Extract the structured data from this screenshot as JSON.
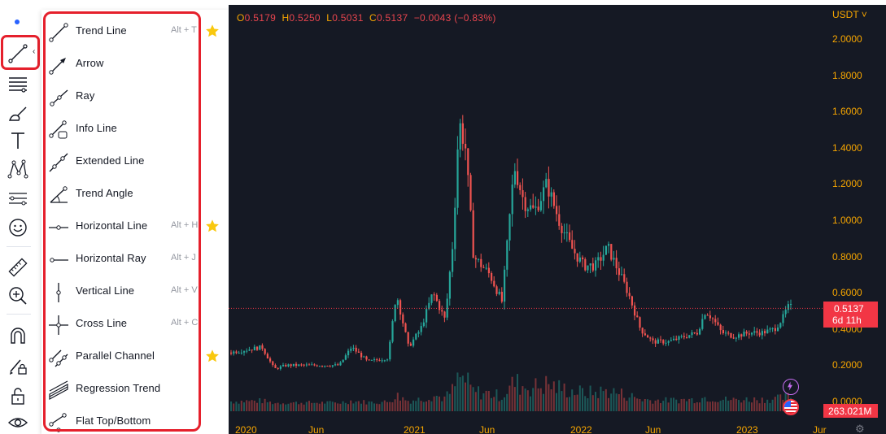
{
  "toolbar": {
    "items": [
      {
        "name": "crosshair-dot",
        "icon": "dot-icon"
      },
      {
        "name": "trend-line-tools",
        "icon": "trend-line-icon",
        "selected": true
      },
      {
        "name": "fib-tools",
        "icon": "fib-lines-icon"
      },
      {
        "name": "brush-tools",
        "icon": "brush-icon"
      },
      {
        "name": "text-tools",
        "icon": "text-icon"
      },
      {
        "name": "pattern-tools",
        "icon": "pattern-icon"
      },
      {
        "name": "prediction-tools",
        "icon": "forecast-icon"
      },
      {
        "name": "emoji-tools",
        "icon": "smiley-icon"
      },
      {
        "name": "measure-tool",
        "icon": "ruler-icon"
      },
      {
        "name": "zoom-tool",
        "icon": "zoom-in-icon"
      },
      {
        "name": "magnet-tool",
        "icon": "magnet-icon"
      },
      {
        "name": "stay-drawing-tool",
        "icon": "pencil-lock-icon"
      },
      {
        "name": "lock-tool",
        "icon": "lock-icon"
      },
      {
        "name": "hide-tool",
        "icon": "eye-icon"
      }
    ],
    "collapse_glyph": "‹"
  },
  "menu": {
    "items": [
      {
        "label": "Trend Line",
        "shortcut": "Alt + T",
        "favorite": true,
        "icon": "trend-line-icon"
      },
      {
        "label": "Arrow",
        "shortcut": "",
        "favorite": false,
        "icon": "arrow-icon"
      },
      {
        "label": "Ray",
        "shortcut": "",
        "favorite": false,
        "icon": "ray-icon"
      },
      {
        "label": "Info Line",
        "shortcut": "",
        "favorite": false,
        "icon": "info-line-icon"
      },
      {
        "label": "Extended Line",
        "shortcut": "",
        "favorite": false,
        "icon": "extended-line-icon"
      },
      {
        "label": "Trend Angle",
        "shortcut": "",
        "favorite": false,
        "icon": "trend-angle-icon"
      },
      {
        "label": "Horizontal Line",
        "shortcut": "Alt + H",
        "favorite": true,
        "icon": "horizontal-line-icon"
      },
      {
        "label": "Horizontal Ray",
        "shortcut": "Alt + J",
        "favorite": false,
        "icon": "horizontal-ray-icon"
      },
      {
        "label": "Vertical Line",
        "shortcut": "Alt + V",
        "favorite": false,
        "icon": "vertical-line-icon"
      },
      {
        "label": "Cross Line",
        "shortcut": "Alt + C",
        "favorite": false,
        "icon": "cross-line-icon"
      },
      {
        "label": "Parallel Channel",
        "shortcut": "",
        "favorite": true,
        "icon": "parallel-channel-icon"
      },
      {
        "label": "Regression Trend",
        "shortcut": "",
        "favorite": false,
        "icon": "regression-trend-icon"
      },
      {
        "label": "Flat Top/Bottom",
        "shortcut": "",
        "favorite": false,
        "icon": "flat-top-bottom-icon"
      }
    ]
  },
  "chart": {
    "ohlc": {
      "o_key": "O",
      "o": "0.5179",
      "h_key": "H",
      "h": "0.5250",
      "l_key": "L",
      "l": "0.5031",
      "c_key": "C",
      "c": "0.5137",
      "change": "−0.0043 (−0.83%)"
    },
    "currency": "USDT",
    "price_ticks": [
      "2.0000",
      "1.8000",
      "1.6000",
      "1.4000",
      "1.2000",
      "1.0000",
      "0.8000",
      "0.6000",
      "0.4000",
      "0.2000",
      "0.0000"
    ],
    "time_ticks": [
      "2020",
      "Jun",
      "2021",
      "Jun",
      "2022",
      "Jun",
      "2023",
      "Jur"
    ],
    "last_price": "0.5137",
    "countdown": "6d 11h",
    "volume": "263.021M",
    "colors": {
      "up": "#26a69a",
      "down": "#ef5350",
      "background": "#151924",
      "axis_text": "#f7a600",
      "accent": "#f23645"
    }
  }
}
